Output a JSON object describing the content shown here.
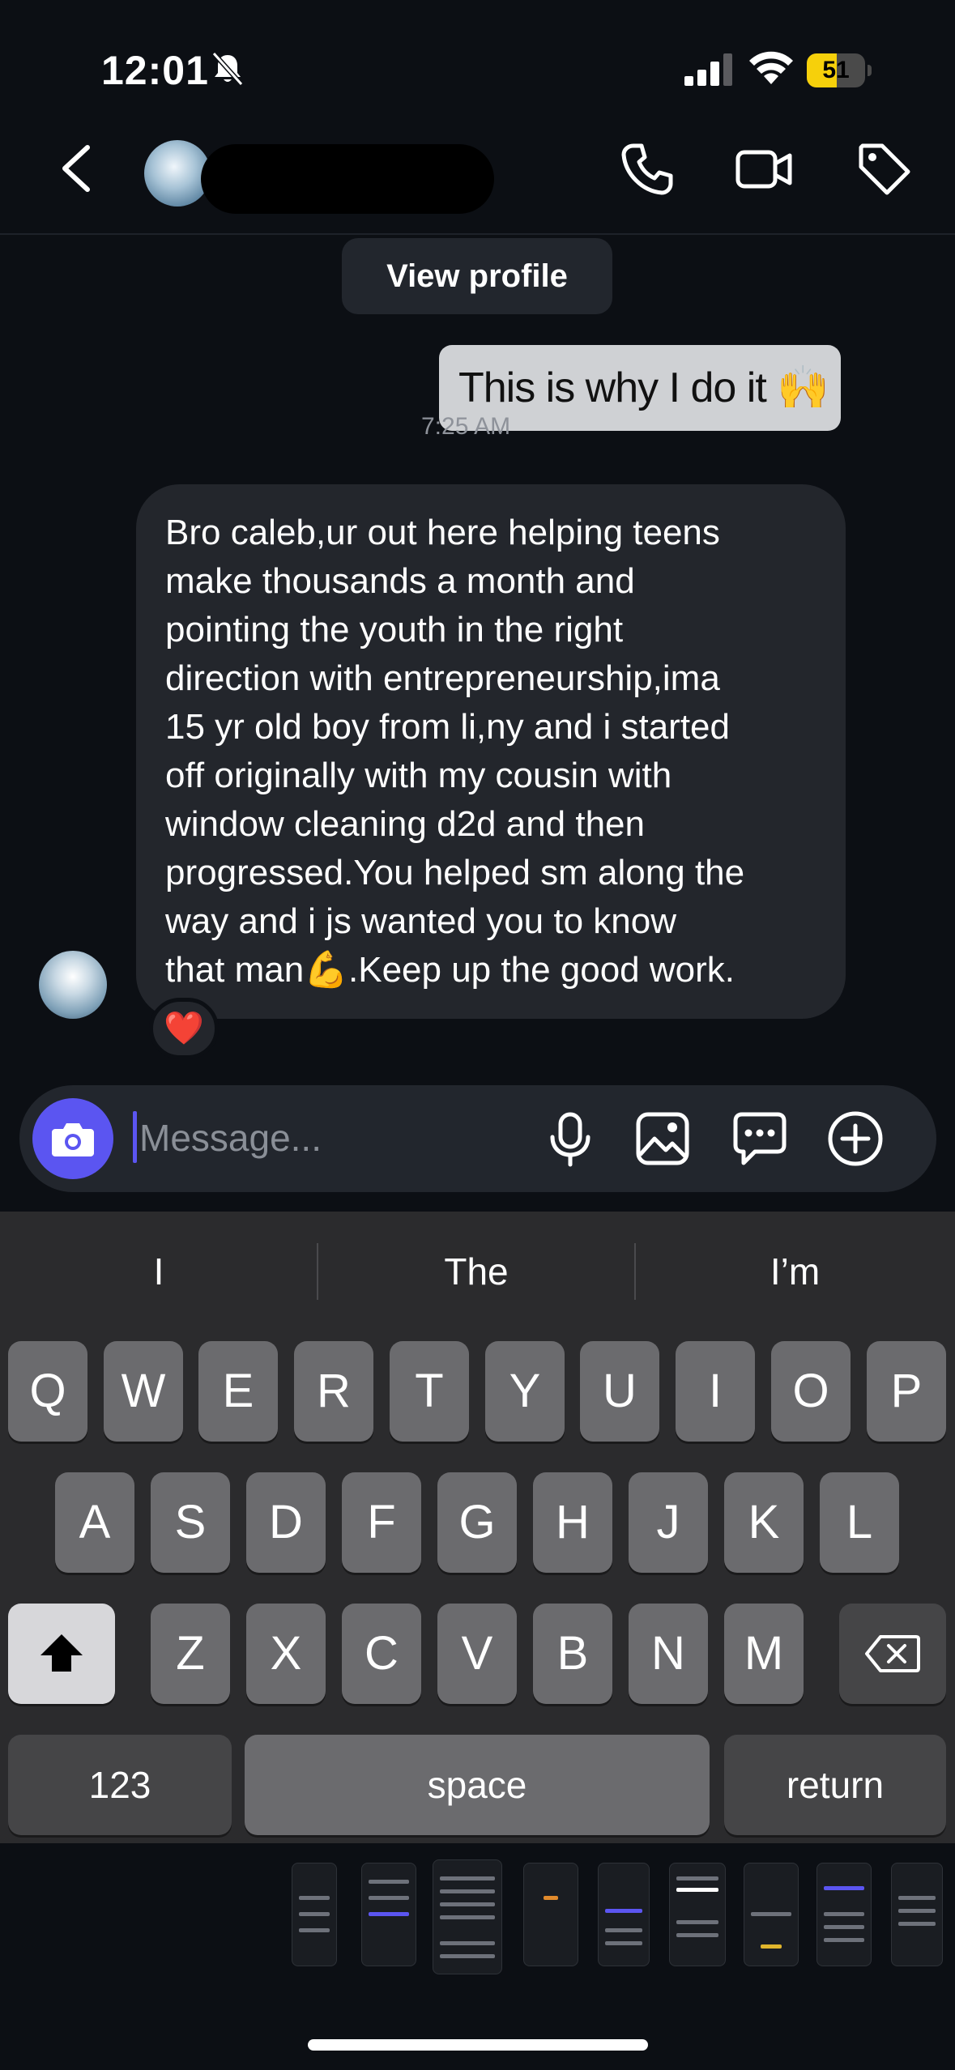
{
  "status_bar": {
    "time": "12:01",
    "battery": "51",
    "battery_level": 0.51,
    "battery_color": "#f6d00b"
  },
  "header": {
    "icons": [
      "back-chevron-icon",
      "phone-icon",
      "video-camera-icon",
      "tag-icon"
    ]
  },
  "view_profile_label": "View profile",
  "messages": {
    "sent": {
      "text": "This is why I do it 🙌",
      "time": "7:25 AM"
    },
    "received": {
      "text": "Bro caleb,ur out here helping teens\nmake thousands a month and\npointing the youth in the right\ndirection with entrepreneurship,ima\n15 yr old boy from li,ny and i started\noff originally with my cousin with\nwindow cleaning d2d and then\nprogressed.You helped sm along the\nway and i js wanted you to know\nthat man💪.Keep up the good work.",
      "reaction": "❤️"
    }
  },
  "composer": {
    "placeholder": "Message...",
    "accent": "#5b55f1"
  },
  "keyboard": {
    "suggestions": [
      "I",
      "The",
      "I’m"
    ],
    "row1": [
      "Q",
      "W",
      "E",
      "R",
      "T",
      "Y",
      "U",
      "I",
      "O",
      "P"
    ],
    "row2": [
      "A",
      "S",
      "D",
      "F",
      "G",
      "H",
      "J",
      "K",
      "L"
    ],
    "row3": [
      "Z",
      "X",
      "C",
      "V",
      "B",
      "N",
      "M"
    ],
    "numbers_label": "123",
    "space_label": "space",
    "return_label": "return"
  }
}
